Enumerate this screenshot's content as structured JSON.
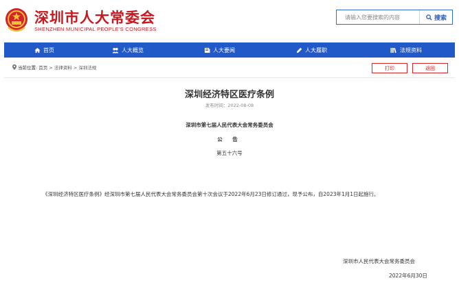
{
  "header": {
    "title": "深圳市人大常委会",
    "subtitle": "SHENZHEN MUNICIPAL PEOPLE'S CONGRESS",
    "logo_icon": "national-emblem-icon",
    "brand_color": "#c9171e"
  },
  "search": {
    "placeholder": "请输入您要搜索的内容",
    "button_label": "搜索",
    "accent": "#2b6cd4"
  },
  "nav": {
    "color": "#2159c8",
    "items": [
      {
        "label": "首页",
        "icon": "home-icon"
      },
      {
        "label": "人大概览",
        "icon": "people-icon"
      },
      {
        "label": "人大要闻",
        "icon": "news-icon"
      },
      {
        "label": "人大履职",
        "icon": "pen-icon"
      },
      {
        "label": "法规资料",
        "icon": "book-icon"
      }
    ]
  },
  "breadcrumb": {
    "label": "当前位置:",
    "path": "首页 > 法律资料 > 深圳法规"
  },
  "actions": {
    "print": "打印",
    "back": "返回"
  },
  "article": {
    "title": "深圳经济特区医疗条例",
    "publish_time": "发布时间：2022-08-08",
    "issuer": "深圳市第七届人民代表大会常务委员会",
    "announcement": "公  告",
    "number": "第五十六号",
    "body": "《深圳经济特区医疗条例》经深圳市第七届人民代表大会常务委员会第十次会议于2022年6月23日修订通过，现予公布，自2023年1月1日起施行。",
    "signature": "深圳市人民代表大会常务委员会",
    "date": "2022年6月30日"
  }
}
